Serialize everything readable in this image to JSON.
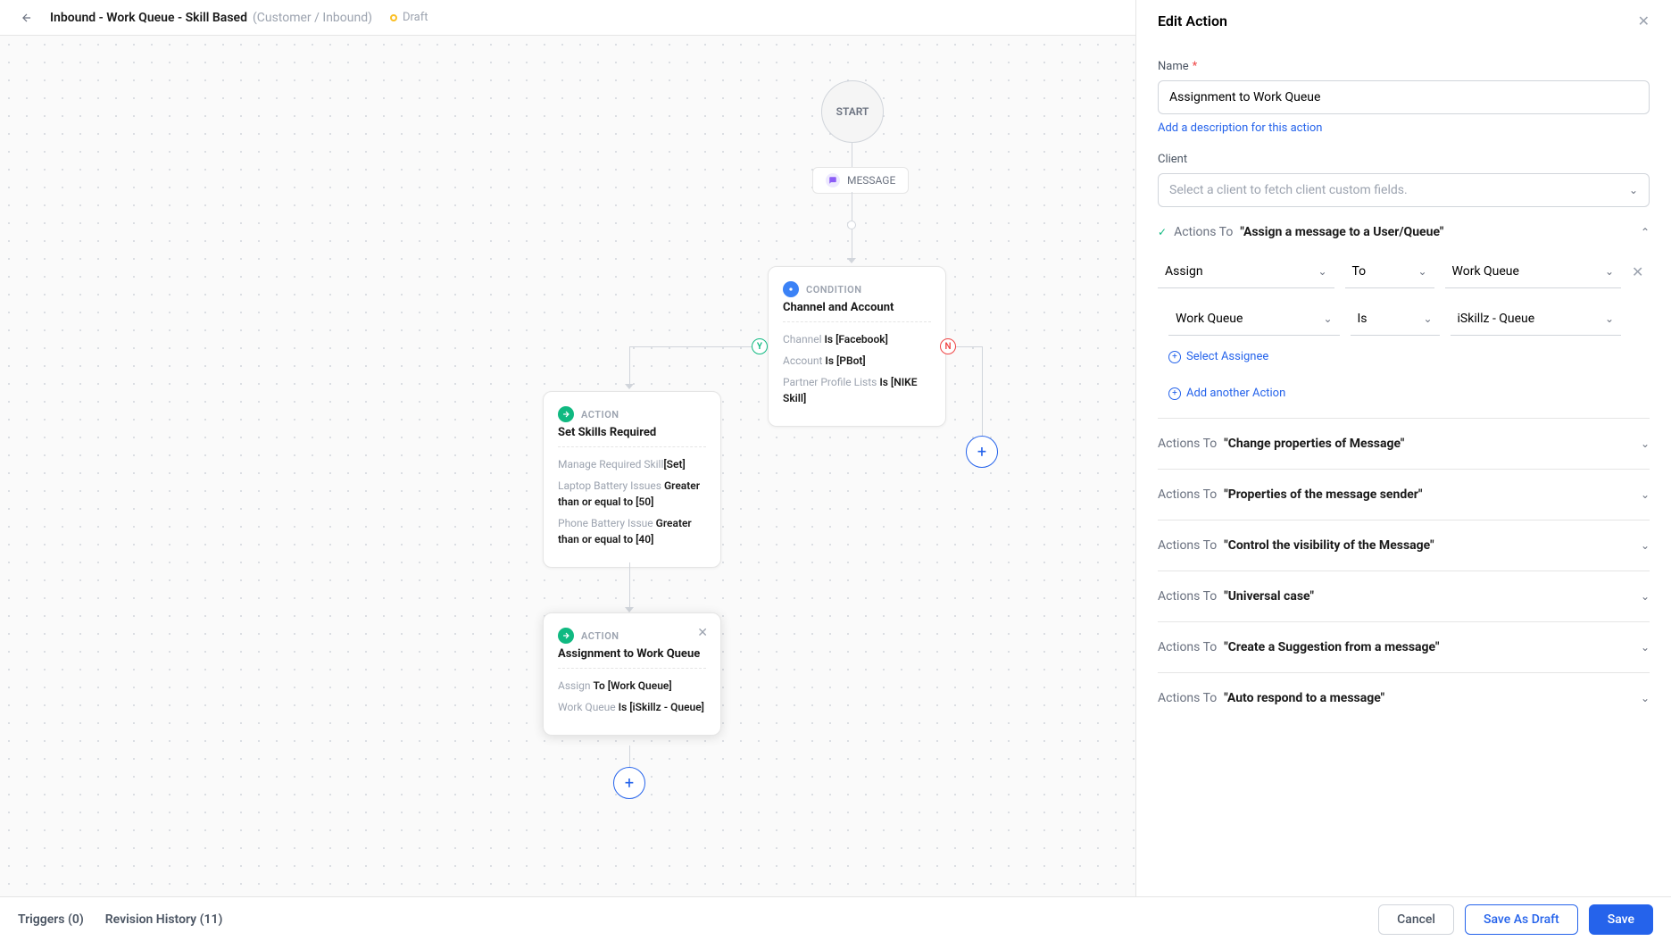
{
  "header": {
    "title": "Inbound - Work Queue - Skill Based",
    "subtitle": "(Customer / Inbound)",
    "status": "Draft"
  },
  "canvas": {
    "start": "START",
    "message_pill": "MESSAGE",
    "condition": {
      "type": "CONDITION",
      "title": "Channel and Account",
      "rows": [
        {
          "field": "Channel",
          "op": "Is",
          "value": "[Facebook]"
        },
        {
          "field": "Account",
          "op": "Is",
          "value": "[PBot]"
        },
        {
          "field": "Partner Profile Lists",
          "op": "Is",
          "value": "[NIKE Skill]"
        }
      ]
    },
    "action1": {
      "type": "ACTION",
      "title": "Set Skills Required",
      "rows": [
        {
          "text_a": "Manage Required Skill",
          "text_b": "[Set]"
        },
        {
          "text_a": "Laptop Battery Issues",
          "text_b": "Greater than or equal to [50]"
        },
        {
          "text_a": "Phone Battery Issue",
          "text_b": "Greater than or equal to [40]"
        }
      ]
    },
    "action2": {
      "type": "ACTION",
      "title": "Assignment to Work Queue",
      "rows": [
        {
          "text_a": "Assign",
          "text_b": "To [Work Queue]"
        },
        {
          "text_a": "Work Queue",
          "text_b": "Is [iSkillz - Queue]"
        }
      ]
    }
  },
  "panel": {
    "title": "Edit Action",
    "name_label": "Name",
    "name_value": "Assignment to Work Queue",
    "add_desc": "Add a description for this action",
    "client_label": "Client",
    "client_placeholder": "Select a client to fetch client custom fields.",
    "actions_prefix": "Actions To",
    "sections": [
      {
        "quoted": "\"Assign a message to a User/Queue\"",
        "expanded": true
      },
      {
        "quoted": "\"Change properties of Message\"",
        "expanded": false
      },
      {
        "quoted": "\"Properties of the message sender\"",
        "expanded": false
      },
      {
        "quoted": "\"Control the visibility of the Message\"",
        "expanded": false
      },
      {
        "quoted": "\"Universal case\"",
        "expanded": false
      },
      {
        "quoted": "\"Create a Suggestion from a message\"",
        "expanded": false
      },
      {
        "quoted": "\"Auto respond to a message\"",
        "expanded": false
      }
    ],
    "filter1": {
      "a": "Assign",
      "b": "To",
      "c": "Work Queue"
    },
    "filter2": {
      "a": "Work Queue",
      "b": "Is",
      "c": "iSkillz - Queue"
    },
    "select_assignee": "Select Assignee",
    "add_another": "Add another Action"
  },
  "footer": {
    "triggers": "Triggers (0)",
    "revision": "Revision History (11)",
    "cancel": "Cancel",
    "save_draft": "Save As Draft",
    "save": "Save"
  }
}
